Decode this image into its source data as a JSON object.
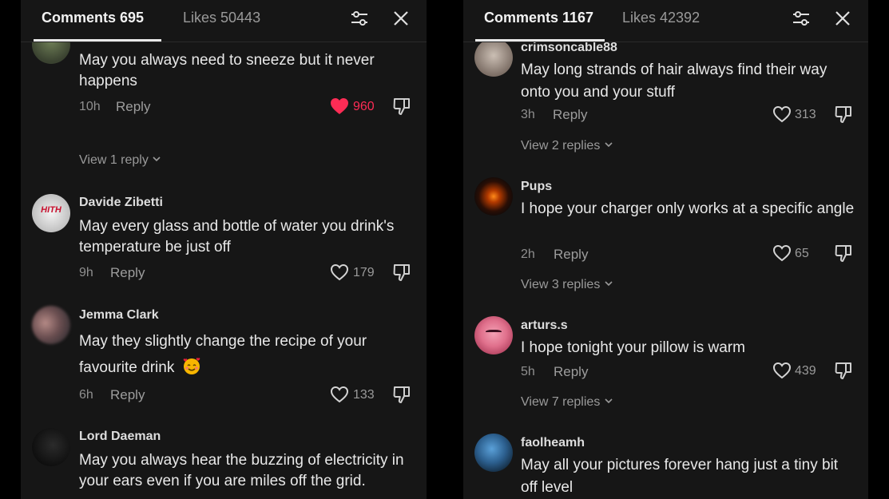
{
  "left": {
    "tabs": {
      "comments": "Comments 695",
      "likes": "Likes 50443"
    },
    "comments": [
      {
        "username": "",
        "text": "May you always need to sneeze but it never happens",
        "time": "10h",
        "reply": "Reply",
        "likes": "960",
        "liked": true,
        "view_replies": "View 1 reply"
      },
      {
        "username": "Davide Zibetti",
        "avatar_text": "HITH",
        "text": "May every glass and bottle of water you drink's temperature be just off",
        "time": "9h",
        "reply": "Reply",
        "likes": "179"
      },
      {
        "username": "Jemma Clark",
        "text": "May they slightly change the recipe of your favourite drink",
        "emoji": "smiling-face-with-hearts",
        "time": "6h",
        "reply": "Reply",
        "likes": "133"
      },
      {
        "username": "Lord Daeman",
        "text": "May you always hear the buzzing of electricity in your ears even if you are miles off the grid."
      }
    ]
  },
  "right": {
    "tabs": {
      "comments": "Comments 1167",
      "likes": "Likes 42392"
    },
    "comments": [
      {
        "username": "crimsoncable88",
        "text": "May long strands of hair always find their way onto you and your stuff",
        "time": "3h",
        "reply": "Reply",
        "likes": "313",
        "view_replies": "View 2 replies"
      },
      {
        "username": "Pups",
        "text": "I hope your charger only works at a specific angle",
        "time": "2h",
        "reply": "Reply",
        "likes": "65",
        "view_replies": "View 3 replies"
      },
      {
        "username": "arturs.s",
        "text": "I hope tonight your pillow is warm",
        "time": "5h",
        "reply": "Reply",
        "likes": "439",
        "view_replies": "View 7 replies"
      },
      {
        "username": "faolheamh",
        "text": "May all your pictures forever hang just a tiny bit off level"
      }
    ]
  },
  "icons": {
    "filter": "filter-sliders-icon",
    "close": "close-icon",
    "like": "heart-icon",
    "dislike": "thumbs-down-icon",
    "chevron": "chevron-down-icon"
  },
  "colors": {
    "panel_bg": "#161616",
    "page_bg": "#000000",
    "liked_heart": "#fe2c55",
    "text": "#e8e8e8",
    "muted": "#9a9a9a"
  }
}
